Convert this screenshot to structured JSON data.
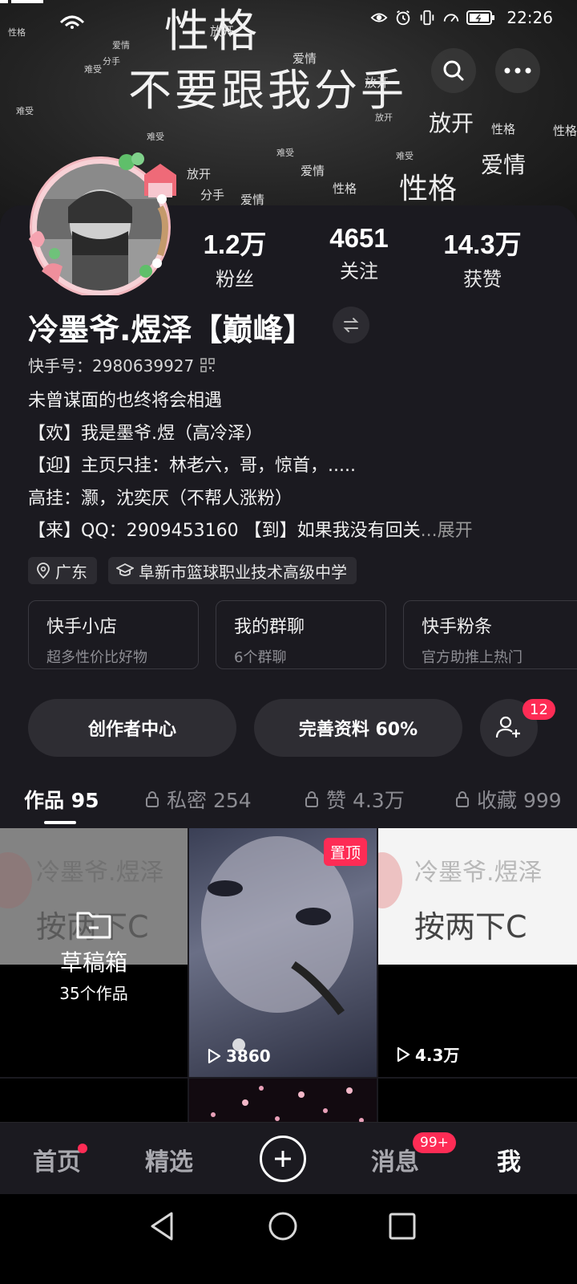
{
  "status_bar": {
    "time": "22:26"
  },
  "banner": {
    "big_title_1": "性格",
    "big_title_2": "不要跟我分手",
    "words": [
      "放开",
      "难受",
      "爱情",
      "分手",
      "性格",
      "难受",
      "放开",
      "爱情",
      "性格"
    ]
  },
  "stats": [
    {
      "value": "1.2万",
      "label": "粉丝"
    },
    {
      "value": "4651",
      "label": "关注"
    },
    {
      "value": "14.3万",
      "label": "获赞"
    }
  ],
  "profile": {
    "nickname": "冷墨爷.煜泽【巅峰】",
    "kuaishou_id_label": "快手号：",
    "kuaishou_id": "2980639927",
    "bio_lines": [
      "未曾谋面的也终将会相遇",
      "【欢】我是墨爷.煜（高冷泽）",
      "【迎】主页只挂：林老六，哥，惊首，.....",
      "高挂：灏，沈奕厌（不帮人涨粉）",
      "【来】QQ：2909453160 【到】如果我没有回关"
    ],
    "bio_ellipsis": "...",
    "bio_expand": "展开",
    "location": "广东",
    "school": "阜新市篮球职业技术高级中学"
  },
  "cards": [
    {
      "title": "快手小店",
      "subtitle": "超多性价比好物"
    },
    {
      "title": "我的群聊",
      "subtitle": "6个群聊"
    },
    {
      "title": "快手粉条",
      "subtitle": "官方助推上热门"
    }
  ],
  "actions": {
    "creator_center": "创作者中心",
    "complete_profile": "完善资料 60%",
    "friend_badge": "12"
  },
  "tabs": [
    {
      "label": "作品 95",
      "locked": false
    },
    {
      "label": "私密 254",
      "locked": true
    },
    {
      "label": "赞 4.3万",
      "locked": true
    },
    {
      "label": "收藏 999",
      "locked": true
    }
  ],
  "grid": {
    "drafts": {
      "thumb_line1": "冷墨爷.煜泽",
      "thumb_line2": "按两下C",
      "title": "草稿箱",
      "count": "35个作品"
    },
    "video2": {
      "pin_label": "置顶",
      "plays": "3860"
    },
    "video3": {
      "thumb_line1": "冷墨爷.煜泽",
      "thumb_line2": "按两下C",
      "plays": "4.3万"
    }
  },
  "bottom_nav": {
    "home": "首页",
    "featured": "精选",
    "messages": "消息",
    "messages_badge": "99+",
    "me": "我"
  },
  "colors": {
    "accent": "#fe2c55",
    "background": "#1b1a20"
  }
}
